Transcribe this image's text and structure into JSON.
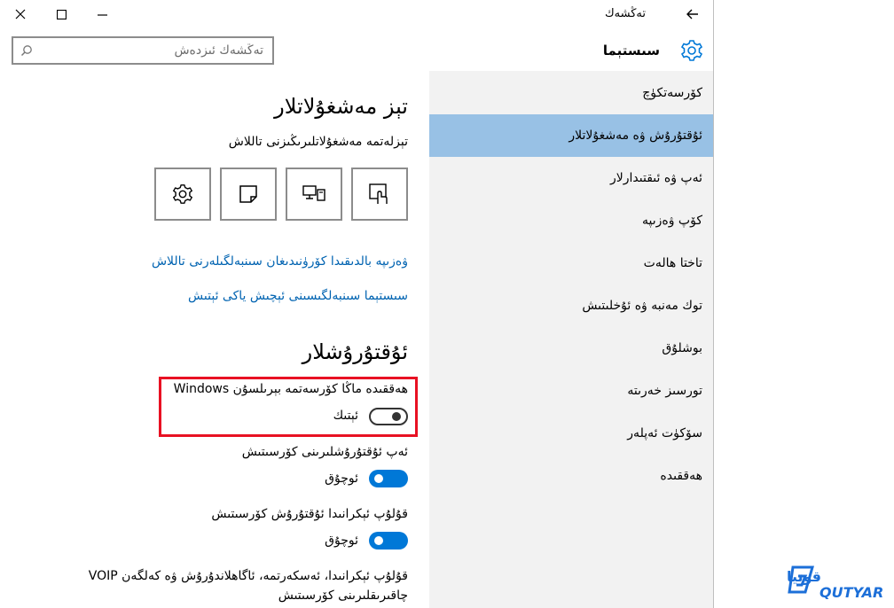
{
  "window": {
    "title": "تەڭشەك",
    "controls": {
      "close": "close-icon",
      "maximize": "maximize-icon",
      "minimize": "minimize-icon",
      "back": "back-arrow-icon"
    }
  },
  "header": {
    "app_title": "سىستېما",
    "search_placeholder": "تەڭشەك ئىزدەش"
  },
  "sidebar": {
    "items": [
      {
        "label": "كۆرسەتكۈچ",
        "selected": false
      },
      {
        "label": "ئۇقتۇرۇش ۋە مەشغۇلاتلار",
        "selected": true
      },
      {
        "label": "ئەپ ۋە ئىقتىدارلار",
        "selected": false
      },
      {
        "label": "كۆپ ۋەزىپە",
        "selected": false
      },
      {
        "label": "تاختا ھالەت",
        "selected": false
      },
      {
        "label": "توك مەنبە ۋە ئۇخلىتىش",
        "selected": false
      },
      {
        "label": "بوشلۇق",
        "selected": false
      },
      {
        "label": "تورسىز خەرىتە",
        "selected": false
      },
      {
        "label": "سۆكۈت ئەپلەر",
        "selected": false
      },
      {
        "label": "ھەققىدە",
        "selected": false
      }
    ]
  },
  "quick_actions": {
    "heading": "تېز مەشغۇلاتلار",
    "subtitle": "تېزلەتمە مەشغۇلاتلىرىڭىزنى تاللاش",
    "tiles": [
      "settings-gear-icon",
      "note-icon",
      "project-display-icon",
      "tablet-mode-icon"
    ],
    "link_taskbar": "ۋەزىپە بالدىقىدا كۆرۈنىدىغان سىنبەلگىلەرنى تاللاش",
    "link_system_icons": "سىستېما سىنبەلگىسىنى ئېچىش ياكى ئېتىش"
  },
  "notifications": {
    "heading": "ئۇقتۇرۇشلار",
    "items": [
      {
        "label": "ھەققىدە ماڭا كۆرسەتمە بېرىلسۇن Windows",
        "state": "ئېتىك",
        "on": false
      },
      {
        "label": "ئەپ ئۇقتۇرۇشلىرىنى كۆرسىتىش",
        "state": "ئوچۇق",
        "on": true
      },
      {
        "label": "قۇلۇپ ئېكرانىدا ئۇقتۇرۇش كۆرسىتىش",
        "state": "ئوچۇق",
        "on": true
      }
    ],
    "last_label_line1": "قۇلۇپ ئېكرانىدا، ئەسكەرتمە، ئاگاھلاندۇرۇش ۋە كەلگەن VOIP",
    "last_label_line2": "چاقىرىقلىرىنى كۆرسىتىش"
  },
  "watermark": {
    "script_text": "قوتيار",
    "latin_text": "QUTYAR",
    "color": "#1c6fd8"
  },
  "colors": {
    "accent": "#0078d7",
    "selected_nav": "#98c1e5",
    "link": "#0063b1",
    "highlight_box": "#e81123",
    "sidebar_bg": "#f2f2f2"
  }
}
